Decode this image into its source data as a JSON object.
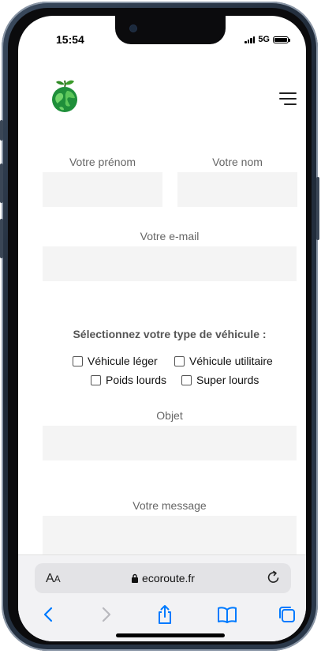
{
  "status_bar": {
    "time": "15:54",
    "network": "5G"
  },
  "header": {
    "logo_icon": "globe-apple-logo-icon",
    "menu_icon": "hamburger-menu-icon"
  },
  "form": {
    "first_name_label": "Votre prénom",
    "last_name_label": "Votre nom",
    "email_label": "Votre e-mail",
    "vehicle_title": "Sélectionnez votre type de véhicule :",
    "vehicle_options": [
      "Véhicule léger",
      "Véhicule utilitaire",
      "Poids lourds",
      "Super lourds"
    ],
    "subject_label": "Objet",
    "message_label": "Votre message"
  },
  "browser": {
    "text_size_label": "AA",
    "url": "ecoroute.fr",
    "icons": [
      "lock-icon",
      "reload-icon",
      "back-icon",
      "forward-icon",
      "share-icon",
      "bookmarks-icon",
      "tabs-icon"
    ]
  },
  "colors": {
    "accent": "#007aff",
    "logo_green": "#1f8f3a",
    "field_bg": "#f4f4f4"
  }
}
